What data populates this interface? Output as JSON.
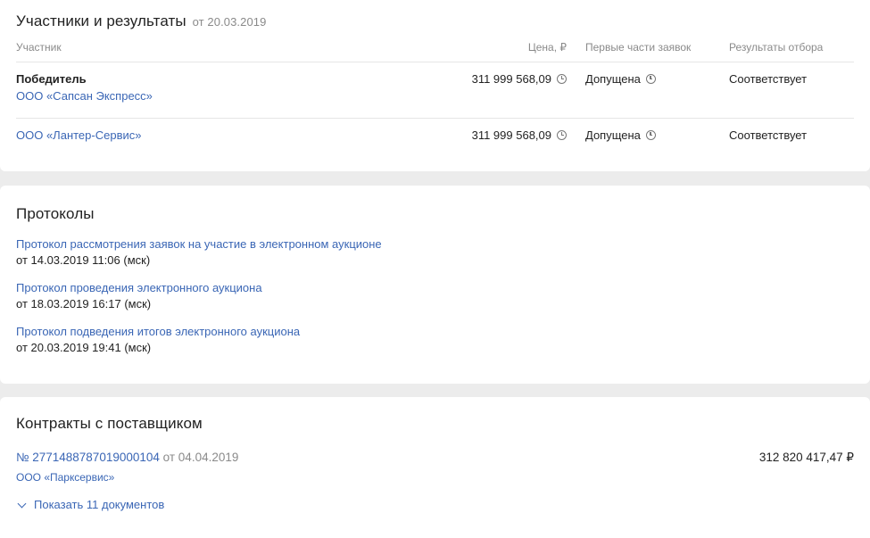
{
  "participants": {
    "title": "Участники и результаты",
    "date": "от 20.03.2019",
    "headers": {
      "participant": "Участник",
      "price": "Цена, ₽",
      "first_parts": "Первые части заявок",
      "results": "Результаты отбора"
    },
    "rows": [
      {
        "label": "Победитель",
        "name": "ООО «Сапсан Экспресс»",
        "price": "311 999 568,09",
        "first_part": "Допущена",
        "result": "Соответствует"
      },
      {
        "label": "",
        "name": "ООО «Лантер-Сервис»",
        "price": "311 999 568,09",
        "first_part": "Допущена",
        "result": "Соответствует"
      }
    ]
  },
  "protocols": {
    "title": "Протоколы",
    "items": [
      {
        "name": "Протокол рассмотрения заявок на участие в электронном аукционе",
        "date": "от 14.03.2019 11:06 (мск)"
      },
      {
        "name": "Протокол проведения электронного аукциона",
        "date": "от 18.03.2019 16:17 (мск)"
      },
      {
        "name": "Протокол подведения итогов электронного аукциона",
        "date": "от 20.03.2019 19:41 (мск)"
      }
    ]
  },
  "contracts": {
    "title": "Контракты с поставщиком",
    "number": "№ 2771488787019000104",
    "date": "от 04.04.2019",
    "sum": "312 820 417,47 ₽",
    "supplier": "ООО «Паркcервис»",
    "show_docs": "Показать 11 документов"
  },
  "colors": {
    "link": "#3a66b5",
    "muted": "#8a8a8a",
    "background": "#ececec"
  },
  "icons": {
    "time": "clock-icon",
    "expand": "chevron-down-icon"
  }
}
